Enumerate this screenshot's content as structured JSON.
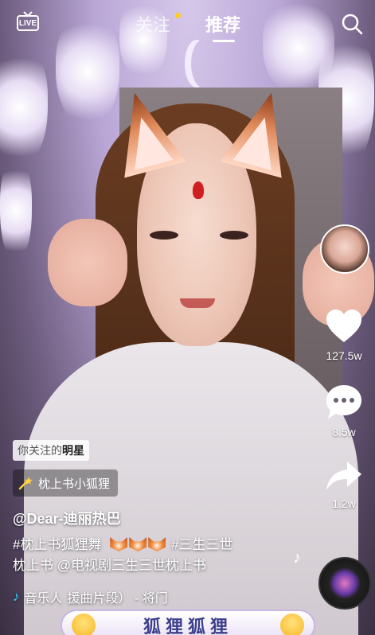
{
  "topbar": {
    "live_label": "LIVE",
    "tabs": [
      {
        "label": "关注",
        "has_dot": true
      },
      {
        "label": "推荐",
        "active": true
      }
    ]
  },
  "right_rail": {
    "like_count": "127.5w",
    "comment_count": "8.5w",
    "share_count": "1.2w"
  },
  "video_info": {
    "star_tag_prefix": "你关注的",
    "star_tag_bold": "明星",
    "effect_name": "枕上书小狐狸",
    "author": "@Dear-迪丽热巴",
    "caption_part1": "#枕上书狐狸舞",
    "caption_part2": "#三生三世",
    "caption_line2": "枕上书 @电视剧三生三世枕上书",
    "music_source": "音乐人",
    "music_title": "援曲片段） - 将门"
  },
  "banner": {
    "text": "狐狸狐狸"
  },
  "colors": {
    "tab_dot": "#ffcc1f",
    "music_accent": "#35d4ff"
  }
}
